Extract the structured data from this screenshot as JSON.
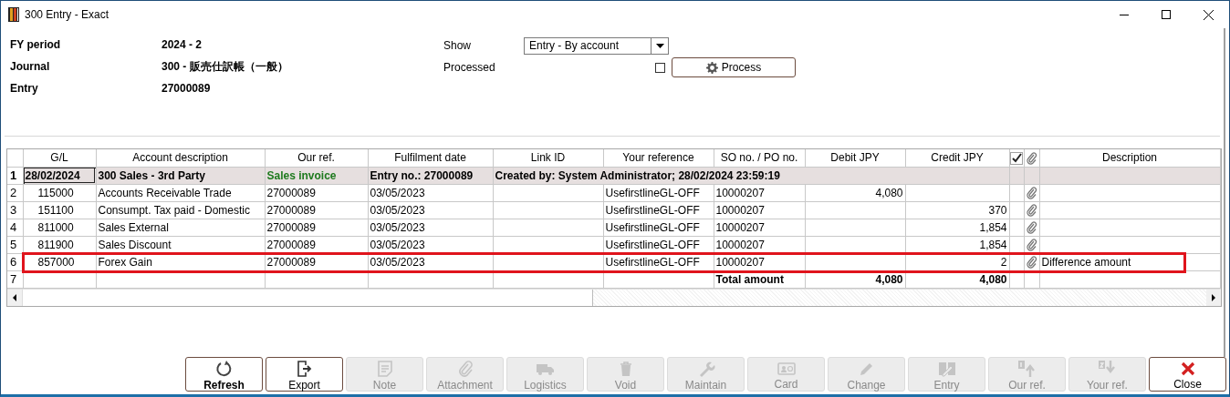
{
  "window": {
    "title": "300 Entry - Exact"
  },
  "header": {
    "fields": [
      {
        "label": "FY period",
        "value": "2024 - 2"
      },
      {
        "label": "Journal",
        "value": "300 - 販売仕訳帳（一般）"
      },
      {
        "label": "Entry",
        "value": "27000089"
      }
    ],
    "show": {
      "label": "Show",
      "value": "Entry - By account"
    },
    "processed": {
      "label": "Processed",
      "checked": false
    },
    "process_button": {
      "label": "Process"
    }
  },
  "grid": {
    "columns": [
      {
        "kind": "text",
        "label": "G/L"
      },
      {
        "kind": "text",
        "label": "Account description"
      },
      {
        "kind": "text",
        "label": "Our ref."
      },
      {
        "kind": "text",
        "label": "Fulfilment date"
      },
      {
        "kind": "text",
        "label": "Link ID"
      },
      {
        "kind": "text",
        "label": "Your reference"
      },
      {
        "kind": "text",
        "label": "SO no. / PO no."
      },
      {
        "kind": "text",
        "label": "Debit JPY"
      },
      {
        "kind": "text",
        "label": "Credit JPY"
      },
      {
        "kind": "processed"
      },
      {
        "kind": "attachment"
      },
      {
        "kind": "text",
        "label": "Description"
      }
    ],
    "rows": [
      {
        "kind": "summary",
        "number": "1",
        "focused": true,
        "highlighted": false,
        "gl": "28/02/2024",
        "account": "300 Sales - 3rd Party",
        "our_ref": "Sales invoice",
        "date": "Entry no.: 27000089",
        "link_id": "Created by: System Administrator; 28/02/2024 23:59:19"
      },
      {
        "kind": "line",
        "number": "2",
        "focused": false,
        "highlighted": false,
        "gl": "115000",
        "account": "Accounts Receivable Trade",
        "our_ref": "27000089",
        "date": "03/05/2023",
        "your_ref": "UsefirstlineGL-OFF",
        "so_po": "10000207",
        "debit": "4,080",
        "attachment": true
      },
      {
        "kind": "line",
        "number": "3",
        "focused": false,
        "highlighted": false,
        "gl": "151100",
        "account": "Consumpt. Tax paid - Domestic",
        "our_ref": "27000089",
        "date": "03/05/2023",
        "your_ref": "UsefirstlineGL-OFF",
        "so_po": "10000207",
        "credit": "370",
        "attachment": true
      },
      {
        "kind": "line",
        "number": "4",
        "focused": false,
        "highlighted": false,
        "gl": "811000",
        "account": "Sales External",
        "our_ref": "27000089",
        "date": "03/05/2023",
        "your_ref": "UsefirstlineGL-OFF",
        "so_po": "10000207",
        "credit": "1,854",
        "attachment": true
      },
      {
        "kind": "line",
        "number": "5",
        "focused": false,
        "highlighted": false,
        "gl": "811900",
        "account": "Sales Discount",
        "our_ref": "27000089",
        "date": "03/05/2023",
        "your_ref": "UsefirstlineGL-OFF",
        "so_po": "10000207",
        "credit": "1,854",
        "attachment": true
      },
      {
        "kind": "line",
        "number": "6",
        "focused": false,
        "highlighted": true,
        "gl": "857000",
        "account": "Forex Gain",
        "our_ref": "27000089",
        "date": "03/05/2023",
        "your_ref": "UsefirstlineGL-OFF",
        "so_po": "10000207",
        "credit": "2",
        "attachment": true,
        "description": "Difference amount"
      },
      {
        "kind": "total",
        "number": "7",
        "focused": false,
        "highlighted": false,
        "so_po": "Total amount",
        "debit": "4,080",
        "credit": "4,080"
      }
    ]
  },
  "toolbar": [
    {
      "kind": "refresh",
      "label": "Refresh",
      "disabled": false,
      "default": true
    },
    {
      "kind": "export",
      "label": "Export",
      "disabled": false,
      "default": false
    },
    {
      "kind": "note",
      "label": "Note",
      "disabled": true,
      "default": false
    },
    {
      "kind": "attachment",
      "label": "Attachment",
      "disabled": true,
      "default": false
    },
    {
      "kind": "logistics",
      "label": "Logistics",
      "disabled": true,
      "default": false
    },
    {
      "kind": "void",
      "label": "Void",
      "disabled": true,
      "default": false
    },
    {
      "kind": "maintain",
      "label": "Maintain",
      "disabled": true,
      "default": false
    },
    {
      "kind": "card",
      "label": "Card",
      "disabled": true,
      "default": false
    },
    {
      "kind": "change",
      "label": "Change",
      "disabled": true,
      "default": false
    },
    {
      "kind": "entry",
      "label": "Entry",
      "disabled": true,
      "default": false
    },
    {
      "kind": "sort_our_ref",
      "label": "Our ref.",
      "disabled": true,
      "default": false
    },
    {
      "kind": "sort_your_ref",
      "label": "Your ref.",
      "disabled": true,
      "default": false
    },
    {
      "kind": "close",
      "label": "Close",
      "disabled": false,
      "default": false
    }
  ]
}
